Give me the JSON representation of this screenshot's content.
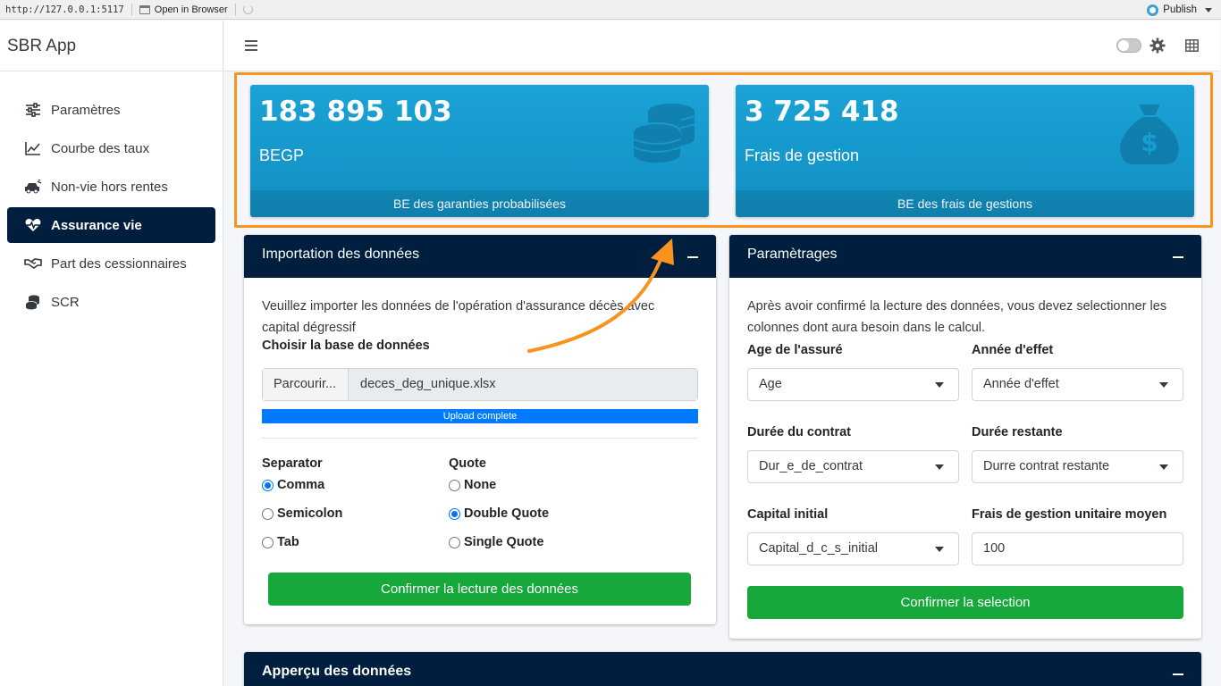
{
  "viewer": {
    "url": "http://127.0.0.1:5117",
    "open_browser": "Open in Browser",
    "publish": "Publish"
  },
  "app": {
    "title": "SBR App"
  },
  "sidebar": {
    "items": [
      {
        "label": "Paramètres",
        "icon": "sliders-icon",
        "active": false
      },
      {
        "label": "Courbe des taux",
        "icon": "line-chart-icon",
        "active": false
      },
      {
        "label": "Non-vie hors rentes",
        "icon": "car-crash-icon",
        "active": false
      },
      {
        "label": "Assurance vie",
        "icon": "heartbeat-icon",
        "active": true
      },
      {
        "label": "Part des cessionnaires",
        "icon": "handshake-icon",
        "active": false
      },
      {
        "label": "SCR",
        "icon": "coins-icon",
        "active": false
      }
    ]
  },
  "value_boxes": [
    {
      "value": "183 895 103",
      "label": "BEGP",
      "footer": "BE des garanties probabilisées",
      "icon": "coins-icon"
    },
    {
      "value": "3 725 418",
      "label": "Frais de gestion",
      "footer": "BE des frais de gestions",
      "icon": "money-bag-icon"
    }
  ],
  "import_card": {
    "title": "Importation des données",
    "intro": "Veuillez importer les données de l'opération d'assurance décès avec capital dégressif",
    "db_label": "Choisir la base de données",
    "browse_label": "Parcourir...",
    "file_name": "deces_deg_unique.xlsx",
    "progress_text": "Upload complete",
    "progress": 1.0,
    "separator": {
      "label": "Separator",
      "options": [
        "Comma",
        "Semicolon",
        "Tab"
      ],
      "selected": "Comma"
    },
    "quote": {
      "label": "Quote",
      "options": [
        "None",
        "Double Quote",
        "Single Quote"
      ],
      "selected": "Double Quote"
    },
    "confirm_button": "Confirmer la lecture des données"
  },
  "param_card": {
    "title": "Paramètrages",
    "intro": "Après avoir confirmé la lecture des données, vous devez selectionner les colonnes dont aura besoin dans le calcul.",
    "fields": {
      "age": {
        "label": "Age de l'assuré",
        "value": "Age"
      },
      "annee": {
        "label": "Année d'effet",
        "value": "Année d'effet"
      },
      "duree": {
        "label": "Durée du contrat",
        "value": "Dur_e_de_contrat"
      },
      "restante": {
        "label": "Durée restante",
        "value": "Durre contrat restante"
      },
      "capital": {
        "label": "Capital initial",
        "value": "Capital_d_c_s_initial"
      },
      "frais": {
        "label": "Frais de gestion unitaire moyen",
        "value": "100"
      }
    },
    "confirm_button": "Confirmer la selection"
  },
  "apercu_card": {
    "title": "Apperçu des données"
  },
  "colors": {
    "navy": "#001f3f",
    "info": "#1ba3d6",
    "success": "#16a83a",
    "primary": "#007bff",
    "highlight": "#f7931e"
  }
}
